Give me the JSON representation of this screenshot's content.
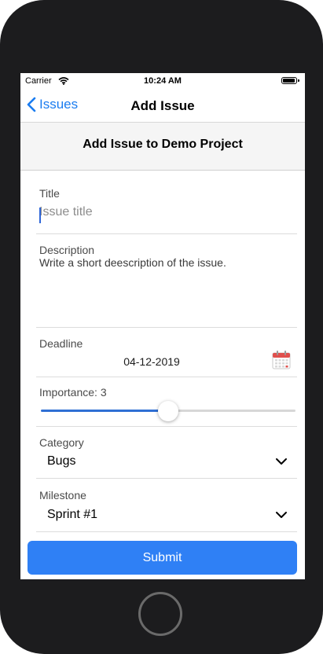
{
  "status_bar": {
    "carrier": "Carrier",
    "time": "10:24 AM"
  },
  "nav": {
    "back_label": "Issues",
    "title": "Add Issue"
  },
  "header": {
    "title": "Add Issue to Demo Project"
  },
  "form": {
    "title_label": "Title",
    "title_placeholder": "Issue title",
    "description_label": "Description",
    "description_placeholder": "Write a short deescription of the issue.",
    "deadline_label": "Deadline",
    "deadline_value": "04-12-2019",
    "importance_label": "Importance: 3",
    "importance_fraction": 0.5,
    "category_label": "Category",
    "category_value": "Bugs",
    "milestone_label": "Milestone",
    "milestone_value": "Sprint #1",
    "submit_label": "Submit"
  },
  "icons": {
    "back": "chevron-left-icon",
    "calendar": "calendar-icon",
    "dropdown": "chevron-down-icon",
    "wifi": "wifi-icon",
    "battery": "battery-icon"
  },
  "colors": {
    "accent": "#1a7cf0",
    "submit_bg": "#2f80f5",
    "slider_fill": "#2f6fd4",
    "calendar_red": "#e0504d"
  }
}
